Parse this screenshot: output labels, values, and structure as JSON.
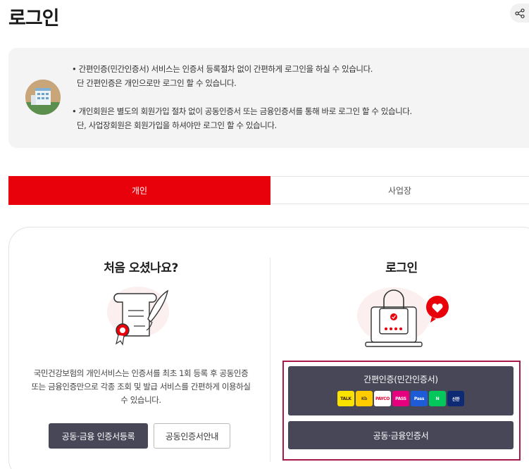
{
  "page": {
    "title": "로그인"
  },
  "notice": {
    "line1": "• 간편인증(민간인증서) 서비스는 인증서 등록절차 없이 간편하게 로그인을 하실 수 있습니다.",
    "line2": "단 간편인증은 개인으로만 로그인 할 수 있습니다.",
    "line3": "• 개인회원은 별도의 회원가입 절차 없이 공동인증서 또는 금융인증서를 통해 바로 로그인 할 수 있습니다.",
    "line4": "단, 사업장회원은 회원가입을 하셔야만 로그인 할 수 있습니다."
  },
  "tabs": [
    {
      "label": "개인",
      "active": true
    },
    {
      "label": "사업장",
      "active": false
    }
  ],
  "left": {
    "title": "처음 오셨나요?",
    "desc_line1": "국민건강보험의 개인서비스는 인증서를 최초 1회 등록 후 공동인증",
    "desc_line2": "또는 금융인증만으로 각종 조회 및 발급 서비스를 간편하게 이용하실",
    "desc_line3": "수 있습니다.",
    "register_button": "공동·금융 인증서등록",
    "guide_button": "공동인증서안내"
  },
  "right": {
    "title": "로그인",
    "easy_button": "간편인증(민간인증서)",
    "cert_button": "공동·금융인증서"
  },
  "providers": [
    {
      "icon": "kakao-talk-icon",
      "text": "TALK",
      "bg": "#fbe300",
      "fg": "#3a1d1d"
    },
    {
      "icon": "kb-icon",
      "text": "Kb",
      "bg": "#ffcc00",
      "fg": "#5a4a2a"
    },
    {
      "icon": "payco-icon",
      "text": "PAYCO",
      "bg": "#ffffff",
      "fg": "#e8002a"
    },
    {
      "icon": "pass-icon",
      "text": "PASS",
      "bg": "#e6007e",
      "fg": "#ffffff"
    },
    {
      "icon": "samsung-pass-icon",
      "text": "Pass",
      "bg": "#1e5bd6",
      "fg": "#ffffff"
    },
    {
      "icon": "naver-icon",
      "text": "N",
      "bg": "#03c75a",
      "fg": "#ffffff"
    },
    {
      "icon": "shinhan-icon",
      "text": "신한",
      "bg": "#0f2a74",
      "fg": "#ffffff"
    }
  ],
  "colors": {
    "accent": "#e8000b",
    "dark_button": "#474757",
    "highlight": "#a8194a"
  }
}
